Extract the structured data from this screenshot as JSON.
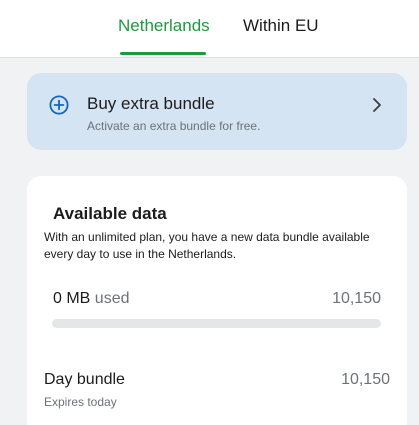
{
  "tabs": [
    {
      "label": "Netherlands",
      "active": true
    },
    {
      "label": "Within EU",
      "active": false
    }
  ],
  "colors": {
    "accent": "#1e9a3c",
    "banner_background": "#d4e4f2",
    "icon_blue": "#1565c0"
  },
  "banner": {
    "title": "Buy extra bundle",
    "subtitle": "Activate an extra bundle for free.",
    "icon": "plus-circle-icon",
    "chevron": "chevron-right-icon"
  },
  "available_data": {
    "title": "Available data",
    "description": "With an unlimited plan, you have a new data bundle available every day to use in the Netherlands.",
    "used_value": "0 MB",
    "used_label": "used",
    "total": "10,150",
    "used_fraction": 0
  },
  "day_bundle": {
    "title": "Day bundle",
    "total": "10,150",
    "expiry": "Expires today"
  }
}
